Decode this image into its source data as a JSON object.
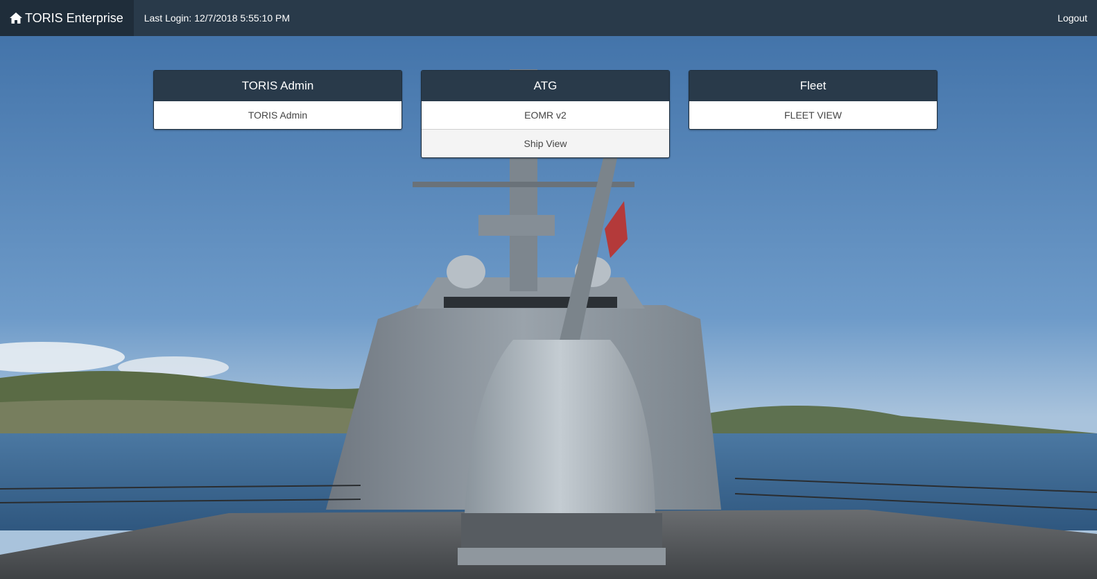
{
  "navbar": {
    "brand": "TORIS Enterprise",
    "brand_icon": "home-icon",
    "last_login_label": "Last Login:",
    "last_login_value": "12/7/2018 5:55:10 PM",
    "logout_label": "Logout",
    "background_color": "#293a4a"
  },
  "panels": [
    {
      "title": "TORIS Admin",
      "items": [
        "TORIS Admin"
      ]
    },
    {
      "title": "ATG",
      "items": [
        "EOMR v2",
        "Ship View"
      ]
    },
    {
      "title": "Fleet",
      "items": [
        "FLEET VIEW"
      ]
    }
  ],
  "background": {
    "description_icon": "navy-destroyer-photo",
    "sky_color": "#4f7fb4",
    "water_color": "#3f6a94",
    "deck_color": "#5a5e63"
  }
}
